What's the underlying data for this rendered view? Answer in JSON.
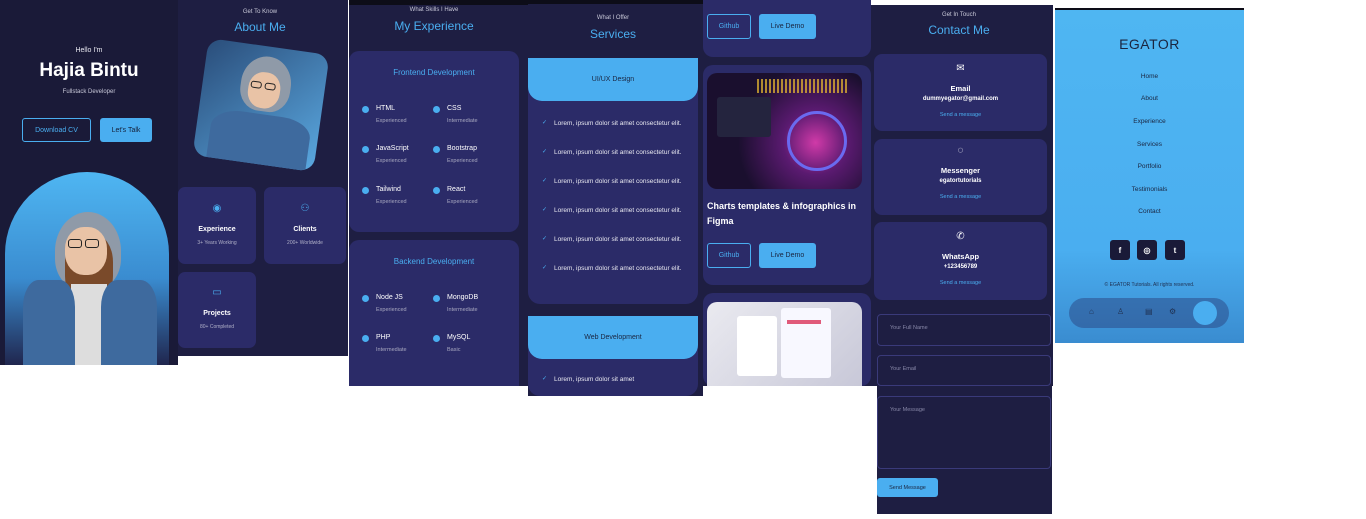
{
  "hero": {
    "greeting": "Hello I'm",
    "name": "Hajia Bintu",
    "role": "Fullstack Developer",
    "download_label": "Download CV",
    "talk_label": "Let's Talk"
  },
  "about": {
    "kicker": "Get To Know",
    "title": "About Me",
    "cards": [
      {
        "icon": "award-icon",
        "title": "Experience",
        "sub": "3+ Years Working"
      },
      {
        "icon": "users-icon",
        "title": "Clients",
        "sub": "200+ Worldwide"
      },
      {
        "icon": "folder-icon",
        "title": "Projects",
        "sub": "80+ Completed"
      }
    ]
  },
  "experience": {
    "kicker": "What Skills I Have",
    "title": "My Experience",
    "frontend_title": "Frontend Development",
    "frontend": [
      {
        "name": "HTML",
        "level": "Experienced"
      },
      {
        "name": "CSS",
        "level": "Intermediate"
      },
      {
        "name": "JavaScript",
        "level": "Experienced"
      },
      {
        "name": "Bootstrap",
        "level": "Experienced"
      },
      {
        "name": "Tailwind",
        "level": "Experienced"
      },
      {
        "name": "React",
        "level": "Experienced"
      }
    ],
    "backend_title": "Backend Development",
    "backend": [
      {
        "name": "Node JS",
        "level": "Experienced"
      },
      {
        "name": "MongoDB",
        "level": "Intermediate"
      },
      {
        "name": "PHP",
        "level": "Intermediate"
      },
      {
        "name": "MySQL",
        "level": "Basic"
      }
    ]
  },
  "services": {
    "kicker": "What I Offer",
    "title": "Services",
    "service1": "UI/UX Design",
    "items": [
      "Lorem, ipsum dolor sit amet consectetur elit.",
      "Lorem, ipsum dolor sit amet consectetur elit.",
      "Lorem, ipsum dolor sit amet consectetur elit.",
      "Lorem, ipsum dolor sit amet consectetur elit.",
      "Lorem, ipsum dolor sit amet consectetur elit.",
      "Lorem, ipsum dolor sit amet consectetur elit."
    ],
    "service2": "Web Development",
    "item2": "Lorem, ipsum dolor sit amet"
  },
  "portfolio": {
    "github_label": "Github",
    "demo_label": "Live Demo",
    "project_title": "Charts templates & infographics in Figma"
  },
  "contact": {
    "kicker": "Get In Touch",
    "title": "Contact Me",
    "cards": [
      {
        "icon": "mail-icon",
        "title": "Email",
        "value": "dummyegator@gmail.com",
        "link": "Send a message"
      },
      {
        "icon": "messenger-icon",
        "title": "Messenger",
        "value": "egatortutorials",
        "link": "Send a message"
      },
      {
        "icon": "whatsapp-icon",
        "title": "WhatsApp",
        "value": "+123456789",
        "link": "Send a message"
      }
    ],
    "name_placeholder": "Your Full Name",
    "email_placeholder": "Your Email",
    "message_placeholder": "Your Message",
    "send_label": "Send Message"
  },
  "menu": {
    "brand": "EGATOR",
    "items": [
      "Home",
      "About",
      "Experience",
      "Services",
      "Portfolio",
      "Testimonials",
      "Contact"
    ],
    "social": [
      "f",
      "◎",
      "t"
    ],
    "copyright": "© EGATOR Tutorials. All rights reserved."
  },
  "colors": {
    "accent": "#4aaef0",
    "background": "#1e1e42",
    "card": "#2b2b68"
  }
}
